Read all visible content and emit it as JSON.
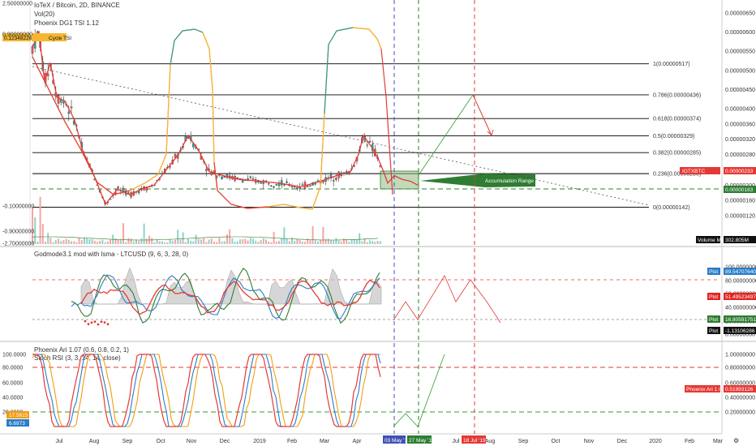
{
  "header": {
    "symbol_line": "IoTeX / Bitcoin, 2D, BINANCE",
    "vol_line": "Vol(20)",
    "indicator_line": "Phoenix DG1 TSI 1.12",
    "cycle_badge_value": "0.12348226",
    "cycle_badge_label": "Cycle TSI"
  },
  "main_pane": {
    "left_axis_ticks": [
      "2.50000000",
      "0.90000000",
      "-0.10000000",
      "-0.90000000",
      "-2.70000000"
    ],
    "right_axis_ticks": [
      "0.00000650",
      "0.00000600",
      "0.00000550",
      "0.00000500",
      "0.00000450",
      "0.00000400",
      "0.00000360",
      "0.00000320",
      "0.00000280",
      "0.00000240",
      "0.00000200",
      "0.00000160",
      "0.00000120"
    ],
    "fib_levels": [
      {
        "label": "1(0.00000517)"
      },
      {
        "label": "0.786(0.00000436)"
      },
      {
        "label": "0.618(0.00000374)"
      },
      {
        "label": "0.5(0.00000329)"
      },
      {
        "label": "0.382(0.00000285)"
      },
      {
        "label": "0.236(0.00000230)"
      },
      {
        "label": "0(0.00000142)"
      }
    ],
    "accumulation_label": "Accumulation Range",
    "price_tag_symbol": "IOTXBTC",
    "price_tag_value": "0.00000233",
    "price_tag_green": "0.00000183",
    "volume_ma_label": "Volume MA",
    "volume_ma_value": "302.805M"
  },
  "pane2": {
    "title": "Godmode3.1 mod with lsma - LTCUSD (9, 6, 3, 28, 0)",
    "right_axis_ticks": [
      "100.00000000",
      "80.00000000",
      "60.00000000",
      "40.00000000",
      "20.00000000",
      "0.00000000"
    ],
    "tags": [
      {
        "label": "Plot",
        "value": "89.54707640",
        "color": "#2a7dc7"
      },
      {
        "label": "Plot",
        "value": "51.49523497",
        "color": "#e02424"
      },
      {
        "label": "Plot",
        "value": "16.80591751",
        "color": "#2e7d32"
      },
      {
        "label": "Plot",
        "value": "-1.13106286",
        "color": "#111111"
      }
    ]
  },
  "pane3": {
    "title1": "Phoenix Ari 1.07 (0.6, 0.8, 0.2, 1)",
    "title2": "Stoch RSI (3, 3, 14, 14, close)",
    "left_axis_ticks": [
      "100.0000",
      "80.0000",
      "60.0000",
      "40.0000",
      "20.0000"
    ],
    "right_axis_ticks": [
      "1.00000000",
      "0.80000000",
      "0.60000000",
      "0.40000000",
      "0.20000000"
    ],
    "left_tag_orange": "17.5615",
    "left_tag_blue": "6.6973",
    "right_tag_label": "Phoenix Ari 1.07",
    "right_tag_value": "0.51993126"
  },
  "time_axis": {
    "labels": [
      "Jul",
      "Aug",
      "Sep",
      "Oct",
      "Nov",
      "Dec",
      "2019",
      "Feb",
      "Mar",
      "Apr",
      "Jul",
      "Aug",
      "Sep",
      "Oct",
      "Nov",
      "Dec",
      "2020",
      "Feb",
      "Mar"
    ],
    "marker_blue": "03 May '19",
    "marker_green": "27 May '19",
    "marker_red": "18 Jul '19"
  },
  "colors": {
    "up_candle": "#26a69a",
    "down_candle": "#ef5350",
    "price_line": "#e53935",
    "fib_line": "#000000",
    "accumulation_fill": "#8fbc7f",
    "blue_marker": "#3f51b5",
    "green_marker": "#2e7d32",
    "red_marker": "#e53935"
  },
  "chart_data": {
    "type": "line",
    "title": "IoTeX / Bitcoin, 2D, BINANCE",
    "series": [
      {
        "name": "IoTeX / Bitcoin",
        "x": [
          "Jul",
          "Aug",
          "Sep",
          "Oct",
          "Nov",
          "Dec",
          "2019",
          "Feb",
          "Mar",
          "Apr"
        ],
        "values": [
          4.8e-06,
          2.5e-06,
          2e-06,
          2.7e-06,
          3e-06,
          2.15e-06,
          2.1e-06,
          2e-06,
          2.05e-06,
          3e-06
        ]
      }
    ],
    "fib_retracement": [
      5.17e-06,
      4.36e-06,
      3.74e-06,
      3.29e-06,
      2.85e-06,
      2.3e-06,
      1.42e-06
    ],
    "ylim": [
      1.2e-06,
      6.5e-06
    ],
    "grid": false
  }
}
